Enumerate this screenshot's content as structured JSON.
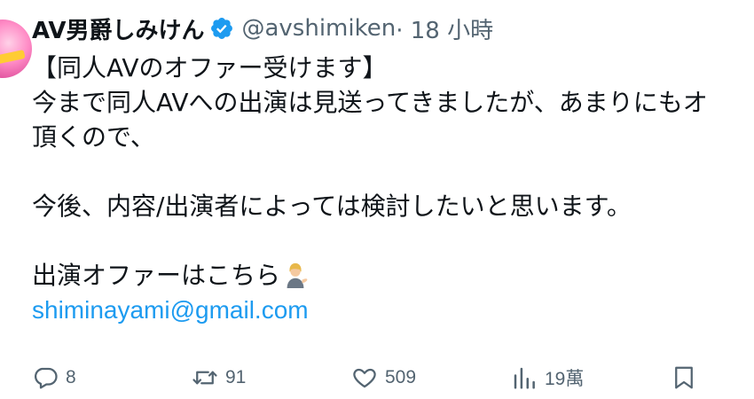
{
  "tweet": {
    "display_name": "AV男爵しみけん",
    "handle": "@avshimiken",
    "time": "· 18 小時",
    "lines": [
      "【同人AVのオファー受けます】",
      "今まで同人AVへの出演は見送ってきましたが、あまりにもオ",
      "頂くので、",
      "",
      "今後、内容/出演者によっては検討したいと思います。",
      "",
      "出演オファーはこちら"
    ],
    "link": "shiminayami@gmail.com"
  },
  "actions": {
    "replies": "8",
    "retweets": "91",
    "likes": "509",
    "views": "19萬"
  },
  "colors": {
    "text": "#0f1419",
    "muted": "#536471",
    "accent": "#1d9bf0"
  },
  "icons": [
    "verified-badge-icon",
    "reply-icon",
    "retweet-icon",
    "like-icon",
    "views-icon",
    "bookmark-icon",
    "person-tipping-hand-emoji"
  ]
}
